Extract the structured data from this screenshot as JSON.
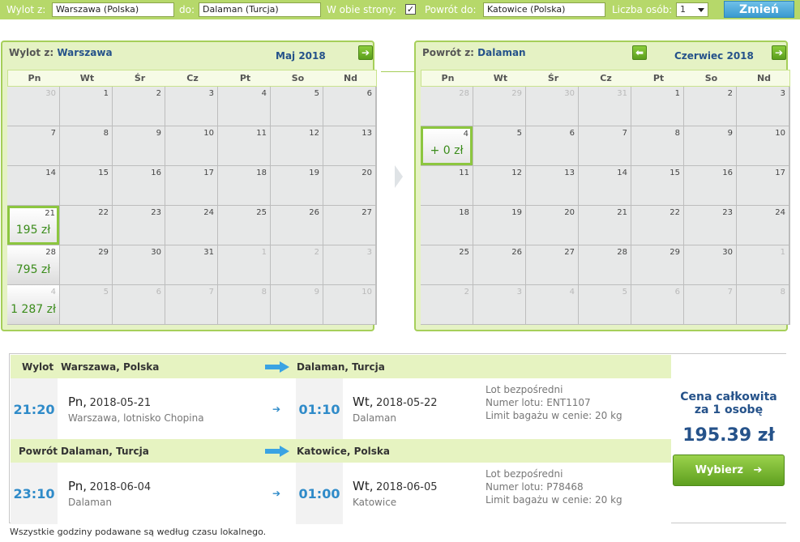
{
  "search": {
    "from_label": "Wylot z:",
    "from_value": "Warszawa (Polska)",
    "to_label": "do:",
    "to_value": "Dalaman (Turcja)",
    "roundtrip_label": "W obie strony:",
    "roundtrip_checked": "✓",
    "return_label": "Powrót do:",
    "return_value": "Katowice (Polska)",
    "persons_label": "Liczba osób:",
    "persons_value": "1",
    "submit_label": "Zmień"
  },
  "calendar_out": {
    "title_prefix": "Wylot z:",
    "title_city": "Warszawa",
    "month": "Maj 2018",
    "next_icon": "arrow-right-icon",
    "weekdays": [
      "Pn",
      "Wt",
      "Śr",
      "Cz",
      "Pt",
      "So",
      "Nd"
    ],
    "weeks": [
      [
        {
          "d": "30",
          "o": true
        },
        {
          "d": "1"
        },
        {
          "d": "2"
        },
        {
          "d": "3"
        },
        {
          "d": "4"
        },
        {
          "d": "5"
        },
        {
          "d": "6"
        }
      ],
      [
        {
          "d": "7"
        },
        {
          "d": "8"
        },
        {
          "d": "9"
        },
        {
          "d": "10"
        },
        {
          "d": "11"
        },
        {
          "d": "12"
        },
        {
          "d": "13"
        }
      ],
      [
        {
          "d": "14"
        },
        {
          "d": "15"
        },
        {
          "d": "16"
        },
        {
          "d": "17"
        },
        {
          "d": "18"
        },
        {
          "d": "19"
        },
        {
          "d": "20"
        }
      ],
      [
        {
          "d": "21",
          "p": "195 zł",
          "s": true
        },
        {
          "d": "22"
        },
        {
          "d": "23"
        },
        {
          "d": "24"
        },
        {
          "d": "25"
        },
        {
          "d": "26"
        },
        {
          "d": "27"
        }
      ],
      [
        {
          "d": "28",
          "p": "795 zł"
        },
        {
          "d": "29"
        },
        {
          "d": "30"
        },
        {
          "d": "31"
        },
        {
          "d": "1",
          "o": true
        },
        {
          "d": "2",
          "o": true
        },
        {
          "d": "3",
          "o": true
        }
      ],
      [
        {
          "d": "4",
          "o": true,
          "p": "1 287 zł"
        },
        {
          "d": "5",
          "o": true
        },
        {
          "d": "6",
          "o": true
        },
        {
          "d": "7",
          "o": true
        },
        {
          "d": "8",
          "o": true
        },
        {
          "d": "9",
          "o": true
        },
        {
          "d": "10",
          "o": true
        }
      ]
    ]
  },
  "calendar_ret": {
    "title_prefix": "Powrót z:",
    "title_city": "Dalaman",
    "month": "Czerwiec 2018",
    "prev_icon": "arrow-left-icon",
    "next_icon": "arrow-right-icon",
    "weekdays": [
      "Pn",
      "Wt",
      "Śr",
      "Cz",
      "Pt",
      "So",
      "Nd"
    ],
    "weeks": [
      [
        {
          "d": "28",
          "o": true
        },
        {
          "d": "29",
          "o": true
        },
        {
          "d": "30",
          "o": true
        },
        {
          "d": "31",
          "o": true
        },
        {
          "d": "1"
        },
        {
          "d": "2"
        },
        {
          "d": "3"
        }
      ],
      [
        {
          "d": "4",
          "p": "+ 0 zł",
          "s": true
        },
        {
          "d": "5"
        },
        {
          "d": "6"
        },
        {
          "d": "7"
        },
        {
          "d": "8"
        },
        {
          "d": "9"
        },
        {
          "d": "10"
        }
      ],
      [
        {
          "d": "11"
        },
        {
          "d": "12"
        },
        {
          "d": "13"
        },
        {
          "d": "14"
        },
        {
          "d": "15"
        },
        {
          "d": "16"
        },
        {
          "d": "17"
        }
      ],
      [
        {
          "d": "18"
        },
        {
          "d": "19"
        },
        {
          "d": "20"
        },
        {
          "d": "21"
        },
        {
          "d": "22"
        },
        {
          "d": "23"
        },
        {
          "d": "24"
        }
      ],
      [
        {
          "d": "25"
        },
        {
          "d": "26"
        },
        {
          "d": "27"
        },
        {
          "d": "28"
        },
        {
          "d": "29"
        },
        {
          "d": "30"
        },
        {
          "d": "1",
          "o": true
        }
      ],
      [
        {
          "d": "2",
          "o": true
        },
        {
          "d": "3",
          "o": true
        },
        {
          "d": "4",
          "o": true
        },
        {
          "d": "5",
          "o": true
        },
        {
          "d": "6",
          "o": true
        },
        {
          "d": "7",
          "o": true
        },
        {
          "d": "8",
          "o": true
        }
      ]
    ]
  },
  "outbound": {
    "label": "Wylot",
    "from": "Warszawa, Polska",
    "to": "Dalaman, Turcja",
    "dep_time": "21:20",
    "dep_day": "Pn,",
    "dep_date": "2018-05-21",
    "dep_place": "Warszawa, lotnisko Chopina",
    "arr_time": "01:10",
    "arr_day": "Wt,",
    "arr_date": "2018-05-22",
    "arr_place": "Dalaman",
    "info_direct": "Lot bezpośredni",
    "info_flight": "Numer lotu: ENT1107",
    "info_baggage": "Limit bagażu w cenie: 20 kg"
  },
  "inbound": {
    "label": "Powrót",
    "from": "Dalaman, Turcja",
    "to": "Katowice, Polska",
    "dep_time": "23:10",
    "dep_day": "Pn,",
    "dep_date": "2018-06-04",
    "dep_place": "Dalaman",
    "arr_time": "01:00",
    "arr_day": "Wt,",
    "arr_date": "2018-06-05",
    "arr_place": "Katowice",
    "info_direct": "Lot bezpośredni",
    "info_flight": "Numer lotu: P78468",
    "info_baggage": "Limit bagażu w cenie: 20 kg"
  },
  "price": {
    "title_line1": "Cena całkowita",
    "title_line2": "za 1 osobę",
    "value": "195.39 zł",
    "button_label": "Wybierz"
  },
  "footnote": "Wszystkie godziny podawane są według czasu lokalnego.",
  "colors": {
    "accent_green": "#8cc63f",
    "bar_green": "#b6d86a",
    "blue_text": "#25528a",
    "time_blue": "#2f8bc9"
  }
}
